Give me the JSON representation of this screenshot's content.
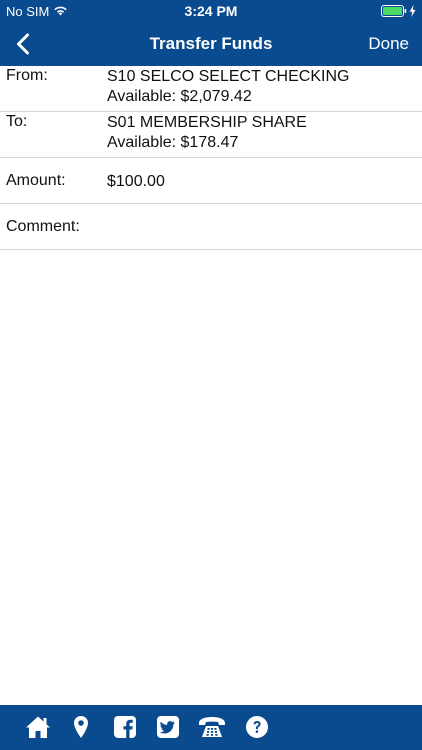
{
  "status_bar": {
    "carrier": "No SIM",
    "time": "3:24 PM"
  },
  "nav": {
    "title": "Transfer Funds",
    "done_label": "Done",
    "back_icon": "chevron-left-icon"
  },
  "form": {
    "from": {
      "label": "From:",
      "account": "S10 SELCO SELECT CHECKING",
      "available": "Available: $2,079.42"
    },
    "to": {
      "label": "To:",
      "account": "S01 MEMBERSHIP SHARE",
      "available": "Available: $178.47"
    },
    "amount": {
      "label": "Amount:",
      "value": "$100.00"
    },
    "comment": {
      "label": "Comment:",
      "value": ""
    }
  },
  "bottom_bar": {
    "icons": [
      "home-icon",
      "location-pin-icon",
      "facebook-icon",
      "twitter-icon",
      "phone-icon",
      "help-icon"
    ]
  },
  "colors": {
    "brand": "#0a4a8f",
    "text": "#111111",
    "divider": "#d6d6d6",
    "battery": "#4cd964"
  }
}
